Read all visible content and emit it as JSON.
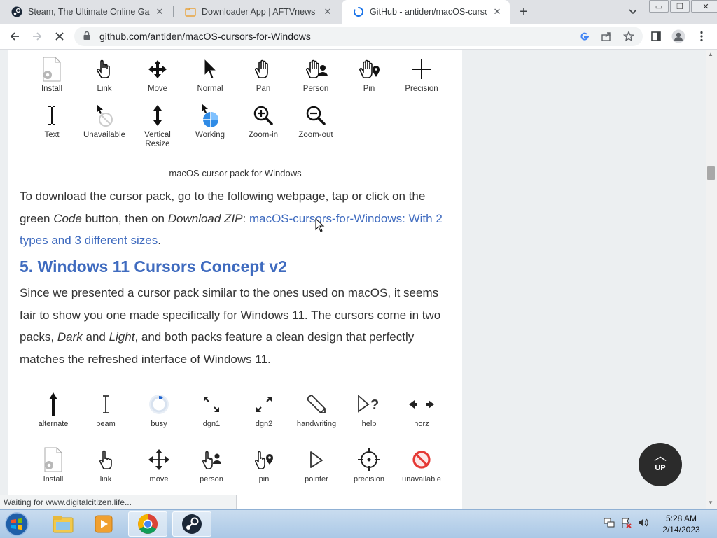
{
  "tabs": [
    {
      "title": "Steam, The Ultimate Online Game Platform",
      "icon": "steam-icon"
    },
    {
      "title": "Downloader App | AFTVnews",
      "icon": "folder-icon"
    },
    {
      "title": "GitHub - antiden/macOS-cursors-for-Windows",
      "icon": "loading-spinner-icon"
    }
  ],
  "window_buttons": {
    "minimize": "▭",
    "restore": "❐",
    "close": "✕"
  },
  "address": {
    "url": "github.com/antiden/macOS-cursors-for-Windows"
  },
  "cursors_macos_row1": [
    "Install",
    "Link",
    "Move",
    "Normal",
    "Pan",
    "Person",
    "Pin",
    "Precision"
  ],
  "cursors_macos_row2": [
    "Text",
    "Unavailable",
    "Vertical Resize",
    "Working",
    "Zoom-in",
    "Zoom-out"
  ],
  "caption": "macOS cursor pack for Windows",
  "para1": {
    "t1": "To download the cursor pack, go to the following webpage, tap or click on the green ",
    "code": "Code",
    "t2": " button, then on ",
    "dz": "Download ZIP",
    "t3": ": ",
    "link": "macOS-cursors-for-Windows: With 2 types and 3 different sizes",
    "t4": "."
  },
  "heading": "5. Windows 11 Cursors Concept v2",
  "para2": {
    "t1": "Since we presented a cursor pack similar to the ones used on macOS, it seems fair to show you one made specifically for Windows 11. The cursors come in two packs, ",
    "dark": "Dark",
    "t2": " and ",
    "light": "Light",
    "t3": ", and both packs feature a clean design that perfectly matches the refreshed interface of Windows 11."
  },
  "cursors_win11_row1": [
    "alternate",
    "beam",
    "busy",
    "dgn1",
    "dgn2",
    "handwriting",
    "help",
    "horz"
  ],
  "cursors_win11_row2": [
    "Install",
    "link",
    "move",
    "person",
    "pin",
    "pointer",
    "precision",
    "unavailable"
  ],
  "up_button": {
    "arrow": "︿",
    "label": "UP"
  },
  "status": "Waiting for www.digitalcitizen.life...",
  "clock": {
    "time": "5:28 AM",
    "date": "2/14/2023"
  },
  "colors": {
    "link": "#3f6bbf",
    "page_bg": "#eceff1"
  }
}
